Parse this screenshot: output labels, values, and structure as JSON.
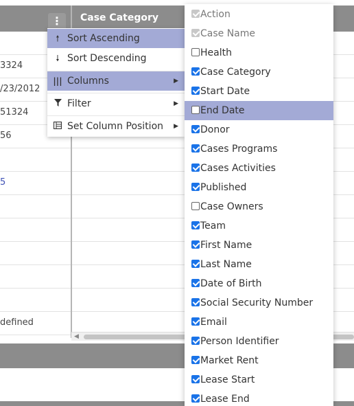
{
  "grid": {
    "header_title": "Case Category",
    "kebab_glyph": "⋮",
    "rows": [
      {
        "text": "",
        "blue": false
      },
      {
        "text": "3324",
        "blue": false
      },
      {
        "text": "/23/2012",
        "blue": false
      },
      {
        "text": "51324",
        "blue": false
      },
      {
        "text": "56",
        "blue": false
      },
      {
        "text": "",
        "blue": false
      },
      {
        "text": "5",
        "blue": true
      },
      {
        "text": "",
        "blue": false
      },
      {
        "text": "",
        "blue": false
      },
      {
        "text": "",
        "blue": false
      },
      {
        "text": "",
        "blue": false
      },
      {
        "text": "",
        "blue": false
      },
      {
        "text": "defined",
        "blue": false
      }
    ]
  },
  "menu": {
    "sort_ascending": "Sort Ascending",
    "sort_descending": "Sort Descending",
    "columns": "Columns",
    "filter": "Filter",
    "set_column_position": "Set Column Position"
  },
  "columns_panel": [
    {
      "label": "Action",
      "state": "disabled"
    },
    {
      "label": "Case Name",
      "state": "disabled"
    },
    {
      "label": "Health",
      "state": "off"
    },
    {
      "label": "Case Category",
      "state": "on"
    },
    {
      "label": "Start Date",
      "state": "on"
    },
    {
      "label": "End Date",
      "state": "off",
      "hover": true
    },
    {
      "label": "Donor",
      "state": "on"
    },
    {
      "label": "Cases Programs",
      "state": "on"
    },
    {
      "label": "Cases Activities",
      "state": "on"
    },
    {
      "label": "Published",
      "state": "on"
    },
    {
      "label": "Case Owners",
      "state": "off"
    },
    {
      "label": "Team",
      "state": "on"
    },
    {
      "label": "First Name",
      "state": "on"
    },
    {
      "label": "Last Name",
      "state": "on"
    },
    {
      "label": "Date of Birth",
      "state": "on"
    },
    {
      "label": "Social Security Number",
      "state": "on"
    },
    {
      "label": "Email",
      "state": "on"
    },
    {
      "label": "Person Identifier",
      "state": "on"
    },
    {
      "label": "Market Rent",
      "state": "on"
    },
    {
      "label": "Lease Start",
      "state": "on"
    },
    {
      "label": "Lease End",
      "state": "on"
    }
  ],
  "colors": {
    "header_bg": "#8c8c8c",
    "active_bg": "#a3aad6",
    "checkbox_on": "#1a73e8"
  }
}
